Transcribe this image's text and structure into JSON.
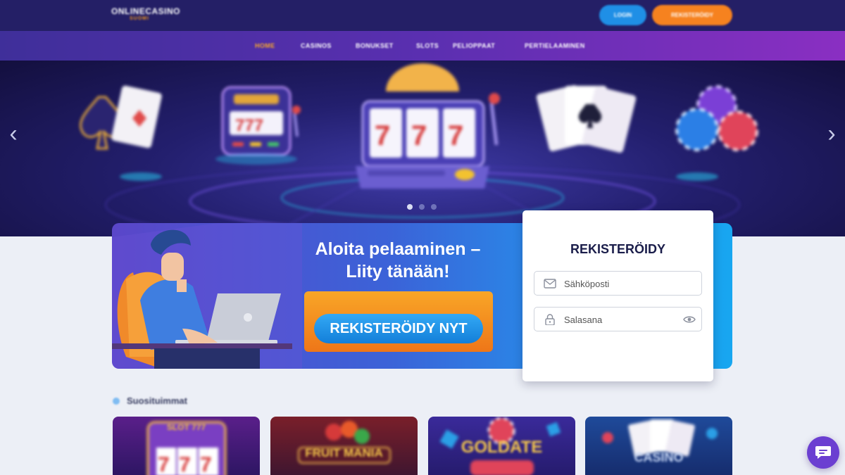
{
  "header": {
    "logo_line1": "ONLINECASINO",
    "logo_line2": "SUOMI",
    "login_label": "LOGIN",
    "signup_label": "REKISTERÖIDY"
  },
  "nav": {
    "items": [
      {
        "label": "HOME",
        "active": true
      },
      {
        "label": "CASINOS",
        "active": false
      },
      {
        "label": "BONUKSET",
        "active": false
      },
      {
        "label": "SLOTS",
        "active": false
      },
      {
        "label": "PELIOPPAAT",
        "active": false
      },
      {
        "label": "PERTIELAAMINEN",
        "active": false
      }
    ]
  },
  "hero": {
    "prev_arrow": "‹",
    "next_arrow": "›",
    "slide_count": 3,
    "active_slide": 1
  },
  "promo": {
    "title_line1": "Aloita pelaaminen –",
    "title_line2": "Liity tänään!",
    "cta_label": "REKISTERÖIDY NYT"
  },
  "register": {
    "title": "REKISTERÖIDY",
    "email_placeholder": "Sähköposti",
    "password_placeholder": "Salasana"
  },
  "popular": {
    "title": "Suosituimmat"
  },
  "games": [
    {
      "title": "SLOT 777"
    },
    {
      "title": "FRUIT MANIA"
    },
    {
      "title": "GOLDATE"
    },
    {
      "title": "CASINO"
    }
  ],
  "colors": {
    "topbar": "#241f66",
    "accent_orange": "#f6821f",
    "accent_blue": "#1f8fe6",
    "chat": "#6b3fd1"
  },
  "icons": {
    "email": "envelope-icon",
    "password": "lock-icon",
    "show_password": "eye-icon",
    "chat": "chat-bubble-icon"
  }
}
